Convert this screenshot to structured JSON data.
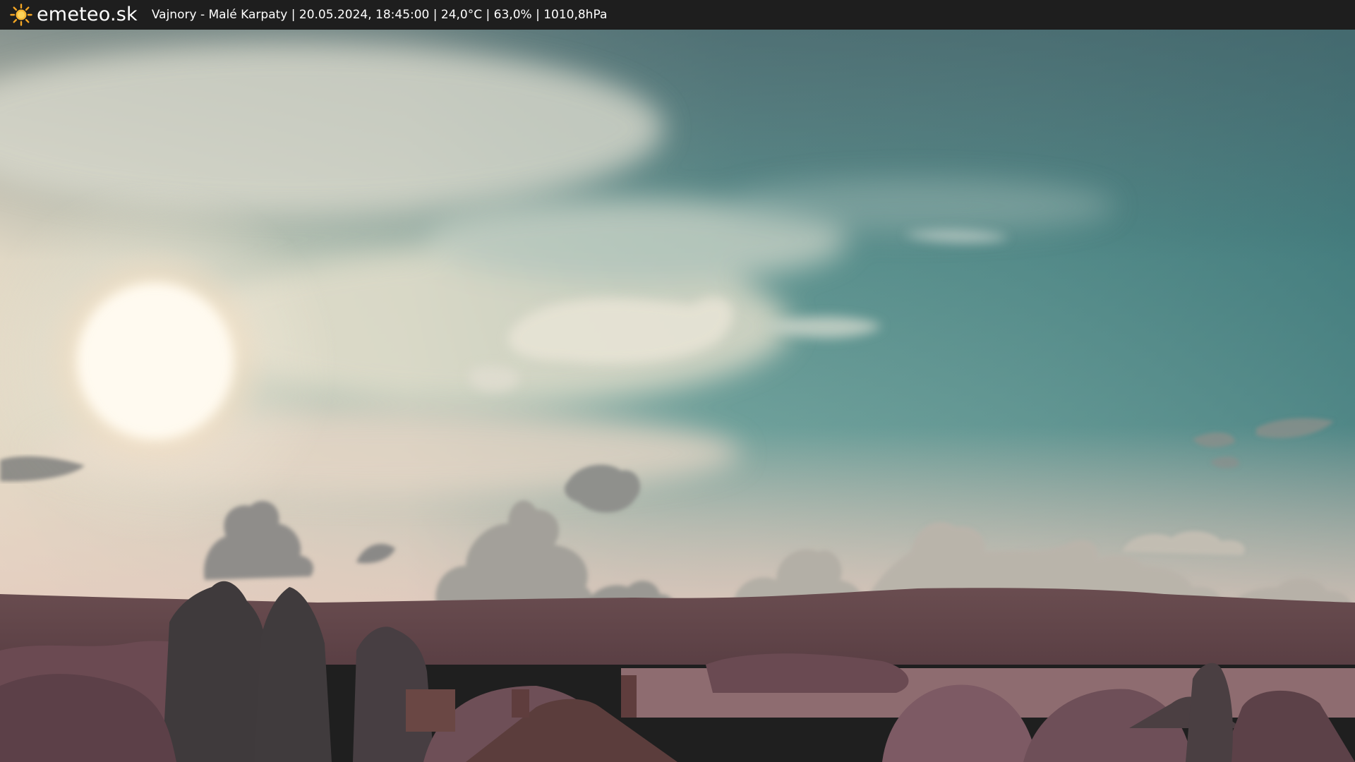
{
  "brand": {
    "logo_icon": "sun-icon",
    "name": "emeteo.sk"
  },
  "camera_info": {
    "location": "Vajnory - Malé Karpaty",
    "datetime": "20.05.2024, 18:45:00",
    "temperature": "24,0°C",
    "humidity": "63,0%",
    "pressure": "1010,8hPa",
    "text": "Vajnory - Malé Karpaty | 20.05.2024, 18:45:00 | 24,0°C | 63,0% | 1010,8hPa"
  },
  "colors": {
    "bar_background": "#1e1e1e",
    "sky_top": "#4f6f73",
    "sky_teal": "#3f8a86",
    "sky_horizon": "#d8c8b8",
    "sun": "#fff8ea",
    "hills": "#6a4f52",
    "foliage": "#7a5560"
  }
}
